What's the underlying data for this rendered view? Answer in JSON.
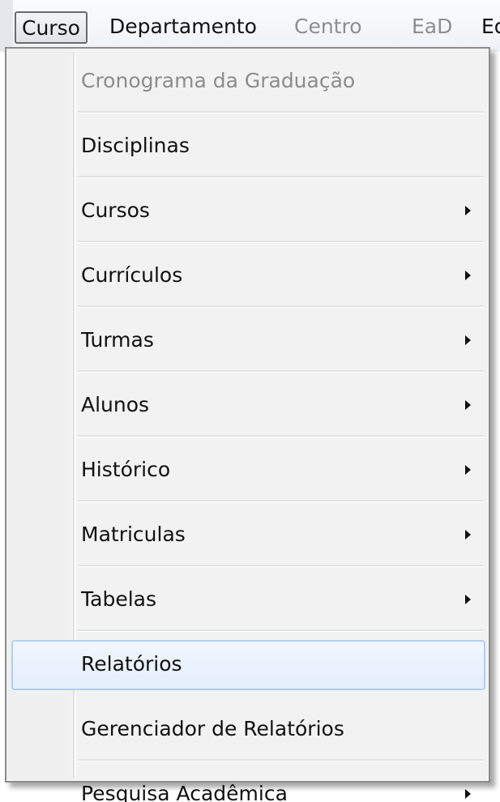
{
  "menubar": {
    "items": [
      {
        "label": "Curso",
        "state": "active"
      },
      {
        "label": "Departamento",
        "state": "enabled"
      },
      {
        "label": "Centro",
        "state": "disabled"
      },
      {
        "label": "EaD",
        "state": "disabled"
      },
      {
        "label": "Ed",
        "state": "enabled"
      }
    ]
  },
  "dropdown": {
    "items": [
      {
        "label": "Cronograma da Graduação",
        "disabled": true,
        "submenu": false
      },
      {
        "label": "Disciplinas",
        "submenu": false
      },
      {
        "label": "Cursos",
        "submenu": true
      },
      {
        "label": "Currículos",
        "submenu": true
      },
      {
        "label": "Turmas",
        "submenu": true
      },
      {
        "label": "Alunos",
        "submenu": true
      },
      {
        "label": "Histórico",
        "submenu": true
      },
      {
        "label": "Matriculas",
        "submenu": true
      },
      {
        "label": "Tabelas",
        "submenu": true
      },
      {
        "label": "Relatórios",
        "submenu": false,
        "highlighted": true
      },
      {
        "label": "Gerenciador de Relatórios",
        "submenu": false
      },
      {
        "label": "Pesquisa Acadêmica",
        "submenu": true
      }
    ]
  },
  "colors": {
    "highlight_border": "#aecff7",
    "highlight_fill": "#e3eefc",
    "menu_background": "#f2f2f2",
    "disabled_text": "#8c8c8c"
  },
  "icons": {
    "submenu_arrow": "chevron-right-icon"
  }
}
